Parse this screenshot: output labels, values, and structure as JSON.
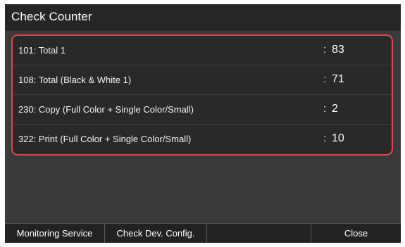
{
  "title": "Check Counter",
  "counters": [
    {
      "label": "101: Total 1",
      "value": "83"
    },
    {
      "label": "108: Total (Black & White 1)",
      "value": "71"
    },
    {
      "label": "230: Copy (Full Color + Single Color/Small)",
      "value": "2"
    },
    {
      "label": "322: Print (Full Color + Single Color/Small)",
      "value": "10"
    }
  ],
  "separator": ":",
  "bottom_bar": {
    "monitoring_label": "Monitoring Service",
    "check_config_label": "Check Dev. Config.",
    "close_label": "Close"
  },
  "colors": {
    "screen_bg": "#3a3a3a",
    "title_bg": "#262626",
    "highlight_border": "#e04848",
    "text": "#ffffff"
  }
}
